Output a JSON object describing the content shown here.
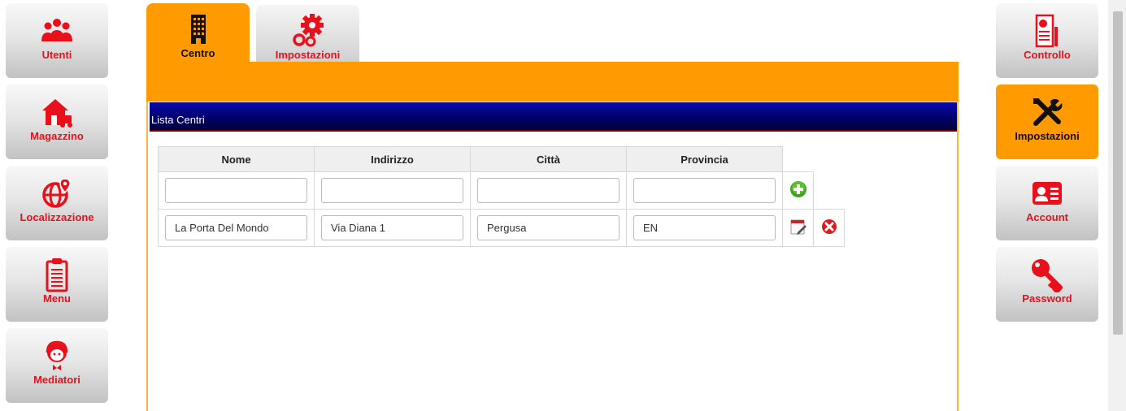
{
  "left_nav": [
    {
      "label": "Utenti",
      "icon": "users-icon"
    },
    {
      "label": "Magazzino",
      "icon": "warehouse-icon"
    },
    {
      "label": "Localizzazione",
      "icon": "globe-pin-icon"
    },
    {
      "label": "Menu",
      "icon": "clipboard-list-icon"
    },
    {
      "label": "Mediatori",
      "icon": "operator-headset-icon"
    }
  ],
  "right_nav": [
    {
      "label": "Controllo",
      "icon": "report-chart-icon"
    },
    {
      "label": "Impostazioni",
      "icon": "tools-icon",
      "active": true
    },
    {
      "label": "Account",
      "icon": "id-card-icon"
    },
    {
      "label": "Password",
      "icon": "key-icon"
    }
  ],
  "tabs": [
    {
      "label": "Centro",
      "icon": "building-icon",
      "active": true
    },
    {
      "label": "Impostazioni",
      "icon": "gears-icon"
    }
  ],
  "panel": {
    "title": "Lista Centri"
  },
  "table": {
    "headers": [
      "Nome",
      "Indirizzo",
      "Città",
      "Provincia"
    ],
    "new_row": [
      "",
      "",
      "",
      ""
    ],
    "rows": [
      {
        "nome": "La Porta Del Mondo",
        "indirizzo": "Via Diana 1",
        "citta": "Pergusa",
        "provincia": "EN"
      }
    ]
  },
  "colors": {
    "accent": "#ff9a00",
    "brand_red": "#e8101a",
    "header_blue": "#00006e"
  }
}
